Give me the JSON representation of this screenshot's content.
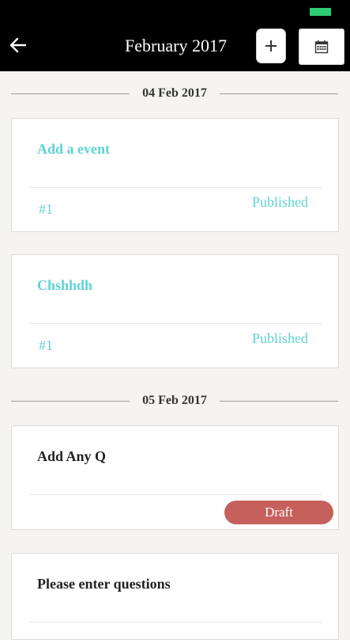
{
  "header": {
    "title": "February 2017",
    "icons": {
      "back": "arrow-left-icon",
      "add": "plus-icon",
      "calendar": "calendar-icon"
    }
  },
  "colors": {
    "accent": "#5fd3d3",
    "draft": "#c5605c",
    "status_bar_battery": "#2ecc71"
  },
  "groups": [
    {
      "date": "04 Feb 2017",
      "items": [
        {
          "title": "Add a event",
          "number": "#1",
          "status": "Published"
        },
        {
          "title": "Chshhdh",
          "number": "#1",
          "status": "Published"
        }
      ]
    },
    {
      "date": "05 Feb 2017",
      "items": [
        {
          "title": "Add Any Q",
          "status": "Draft"
        },
        {
          "title": "Please enter questions"
        }
      ]
    }
  ]
}
